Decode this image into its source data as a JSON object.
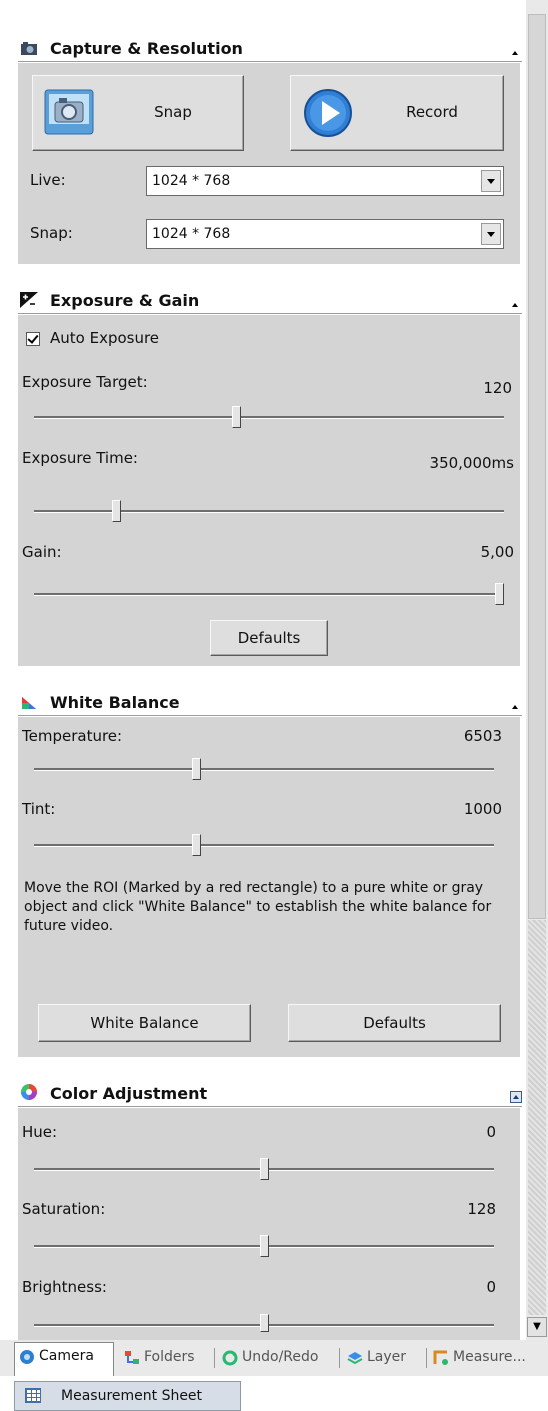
{
  "capture": {
    "title": "Capture & Resolution",
    "snap_label": "Snap",
    "record_label": "Record",
    "live_label": "Live:",
    "live_value": "1024 * 768",
    "snap_label2": "Snap:",
    "snap_value": "1024 * 768"
  },
  "exposure": {
    "title": "Exposure & Gain",
    "auto_label": "Auto Exposure",
    "auto_checked": true,
    "target_label": "Exposure Target:",
    "target_value": "120",
    "target_level": 0.43,
    "time_label": "Exposure Time:",
    "time_value": "350,000ms",
    "time_level": 0.17,
    "gain_label": "Gain:",
    "gain_value": "5,00",
    "gain_level": 1.0,
    "defaults_label": "Defaults"
  },
  "white_balance": {
    "title": "White Balance",
    "temp_label": "Temperature:",
    "temp_value": "6503",
    "temp_level": 0.35,
    "tint_label": "Tint:",
    "tint_value": "1000",
    "tint_level": 0.35,
    "instruction": "Move the ROI (Marked by a red rectangle) to a pure white or gray object and click \"White Balance\" to establish the white balance for future video.",
    "wb_button": "White Balance",
    "defaults_label": "Defaults"
  },
  "color": {
    "title": "Color Adjustment",
    "hue_label": "Hue:",
    "hue_value": "0",
    "hue_level": 0.5,
    "sat_label": "Saturation:",
    "sat_value": "128",
    "sat_level": 0.5,
    "bright_label": "Brightness:",
    "bright_value": "0",
    "bright_level": 0.5
  },
  "tabs": {
    "camera": "Camera",
    "folders": "Folders",
    "undo": "Undo/Redo",
    "layer": "Layer",
    "measure": "Measure..."
  },
  "bottom": {
    "sheet_tab": "Measurement Sheet"
  }
}
